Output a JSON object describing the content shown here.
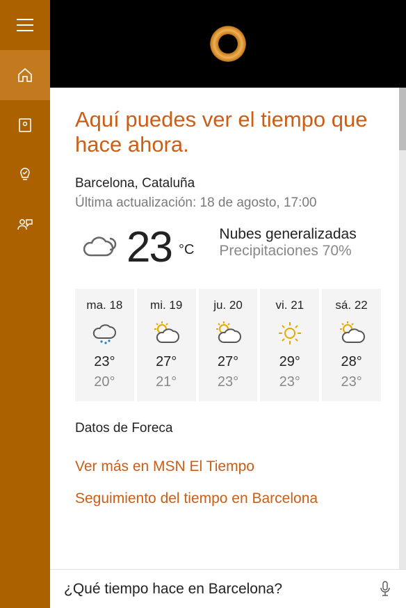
{
  "heading": "Aquí puedes ver el tiempo que hace ahora.",
  "location": "Barcelona, Cataluña",
  "updated": "Última actualización: 18 de agosto, 17:00",
  "current": {
    "temp": "23",
    "unit": "°C",
    "condition": "Nubes generalizadas",
    "precip": "Precipitaciones 70%"
  },
  "forecast": [
    {
      "day": "ma. 18",
      "icon": "rain",
      "hi": "23°",
      "lo": "20°"
    },
    {
      "day": "mi. 19",
      "icon": "partly-sun",
      "hi": "27°",
      "lo": "21°"
    },
    {
      "day": "ju. 20",
      "icon": "partly-sun",
      "hi": "27°",
      "lo": "23°"
    },
    {
      "day": "vi. 21",
      "icon": "sun",
      "hi": "29°",
      "lo": "23°"
    },
    {
      "day": "sá. 22",
      "icon": "partly-sun",
      "hi": "28°",
      "lo": "23°"
    }
  ],
  "source": "Datos de Foreca",
  "link_more": "Ver más en MSN El Tiempo",
  "link_follow": "Seguimiento del tiempo en Barcelona",
  "input_value": "¿Qué tiempo hace en Barcelona?"
}
